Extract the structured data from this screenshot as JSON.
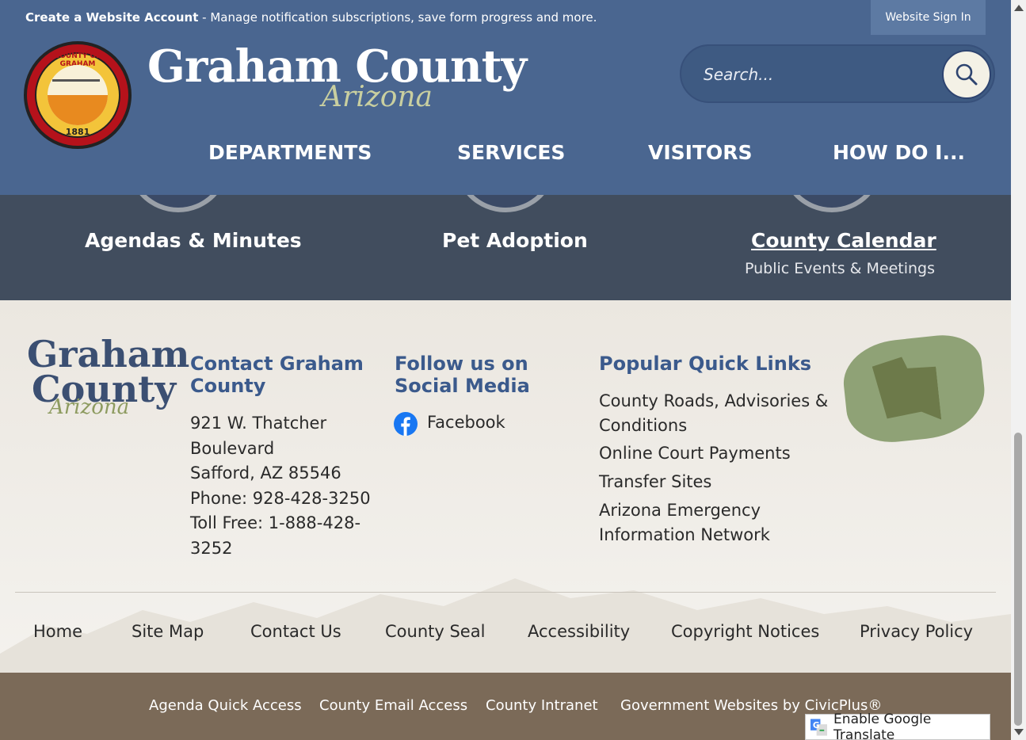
{
  "topbar": {
    "create_account": "Create a Website Account",
    "message": " - Manage notification subscriptions, save form progress and more.",
    "signin": "Website Sign In"
  },
  "header": {
    "seal_top": "COUNTY OF GRAHAM",
    "seal_year": "1881",
    "brand_name": "Graham County",
    "brand_state": "Arizona",
    "search_placeholder": "Search...",
    "nav": [
      "DEPARTMENTS",
      "SERVICES",
      "VISITORS",
      "HOW DO I..."
    ]
  },
  "band": {
    "items": [
      {
        "label": "Agendas & Minutes"
      },
      {
        "label": "Pet Adoption"
      },
      {
        "label": "County Calendar",
        "sub": "Public Events & Meetings"
      }
    ]
  },
  "footer": {
    "logo_line1": "Graham",
    "logo_line2": "County",
    "logo_line3": "Arizona",
    "contact_heading": "Contact Graham County",
    "contact_lines": [
      "921 W. Thatcher",
      "Boulevard",
      "Safford, AZ 85546",
      "Phone: 928-428-3250",
      "Toll Free: 1-888-428-",
      "3252"
    ],
    "social_heading": "Follow us on Social Media",
    "facebook": "Facebook",
    "quicklinks_heading": "Popular Quick Links",
    "quicklinks": [
      "County Roads, Advisories &",
      "Conditions",
      "Online Court Payments",
      "Transfer Sites",
      "Arizona Emergency",
      "Information Network"
    ],
    "links": [
      "Home",
      "Site Map",
      "Contact Us",
      "County Seal",
      "Accessibility",
      "Copyright Notices",
      "Privacy Policy"
    ],
    "bottom_links": [
      "Agenda Quick Access",
      "County Email Access",
      "County Intranet",
      "Government Websites by CivicPlus®"
    ],
    "translate": "Enable Google Translate"
  },
  "colors": {
    "header_blue": "#4a6690",
    "band_dark": "#414d5e",
    "heading_blue": "#3b5a8c",
    "bottom_brown": "#7b6a58"
  }
}
